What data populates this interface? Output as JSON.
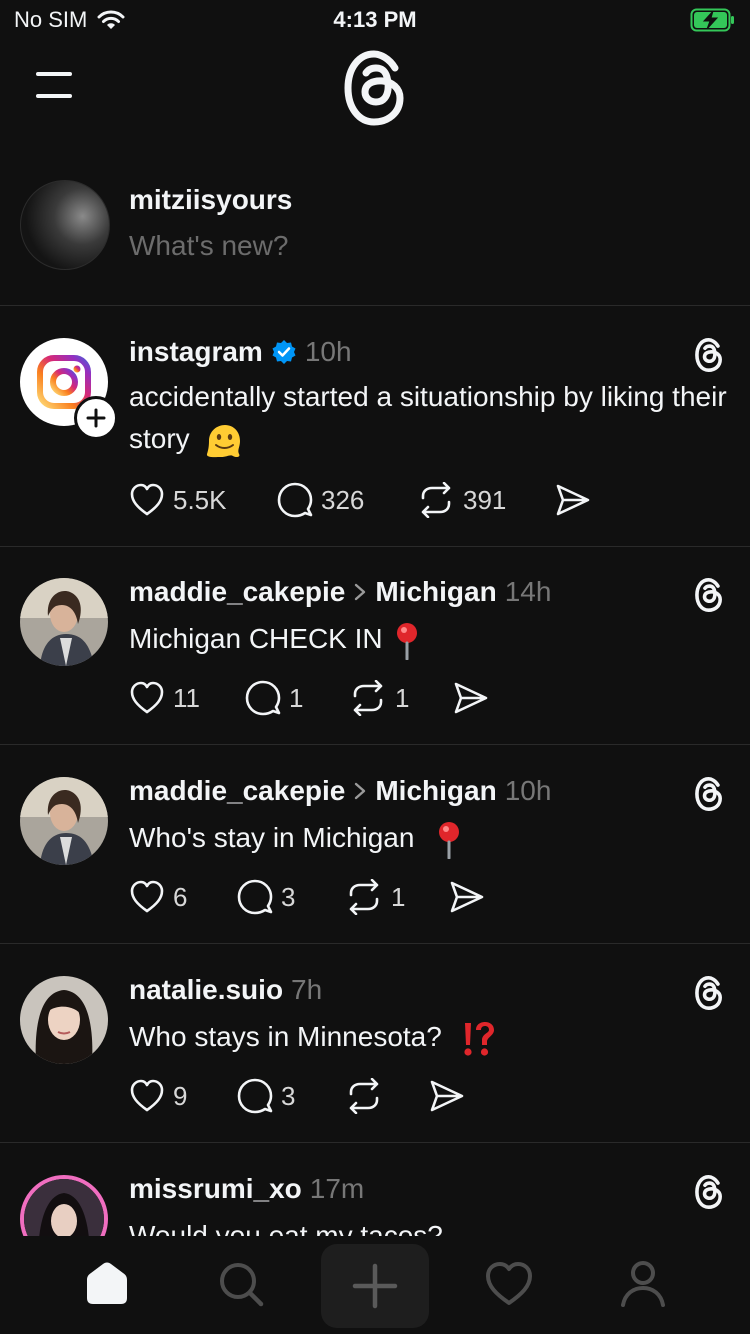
{
  "status_bar": {
    "carrier": "No SIM",
    "time": "4:13 PM"
  },
  "composer": {
    "username": "mitziisyours",
    "placeholder": "What's new?"
  },
  "posts": [
    {
      "username": "instagram",
      "verified": true,
      "location": "",
      "time": "10h",
      "text": "accidentally started a situationship by liking their story",
      "emoji": "melting-face",
      "likes": "5.5K",
      "replies": "326",
      "reposts": "391"
    },
    {
      "username": "maddie_cakepie",
      "location": "Michigan",
      "time": "14h",
      "text": "Michigan CHECK IN",
      "emoji": "round-pushpin",
      "likes": "11",
      "replies": "1",
      "reposts": "1"
    },
    {
      "username": "maddie_cakepie",
      "location": "Michigan",
      "time": "10h",
      "text": "Who's stay in Michigan",
      "emoji": "round-pushpin",
      "likes": "6",
      "replies": "3",
      "reposts": "1"
    },
    {
      "username": "natalie.suio",
      "location": "",
      "time": "7h",
      "text": "Who stays in Minnesota?",
      "emoji": "interrobang",
      "likes": "9",
      "replies": "3",
      "reposts": ""
    },
    {
      "username": "missrumi_xo",
      "location": "",
      "time": "17m",
      "text": "Would you eat my tacos?"
    }
  ],
  "tabs": [
    "home",
    "search",
    "create",
    "activity",
    "profile"
  ],
  "colors": {
    "background": "#101010",
    "verified": "#0095f6",
    "battery": "#34c759",
    "text": "#f3f5f7",
    "muted": "#777777"
  }
}
